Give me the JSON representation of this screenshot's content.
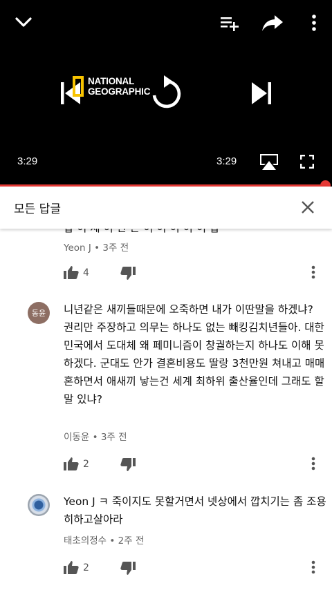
{
  "player": {
    "logo_line1": "NATIONAL",
    "logo_line2": "GEOGRAPHIC",
    "time_current": "3:29",
    "time_total": "3:29",
    "progress": 0.98,
    "accent_color": "#e53935",
    "icons": [
      "chevron-down-icon",
      "add-to-queue-icon",
      "share-icon",
      "more-vert-icon",
      "skip-previous-icon",
      "replay-icon",
      "skip-next-icon",
      "airplay-icon",
      "fullscreen-icon"
    ]
  },
  "header": {
    "title": "모든 답글",
    "close_icon": "close-icon"
  },
  "comments": [
    {
      "partial_text": "답 이 제 이 한 은 이 이 이 이 이 답",
      "author": "Yeon J",
      "age": "3주 전",
      "likes": "4"
    },
    {
      "avatar_text": "동윤",
      "text": "니년같은 새끼들때문에 오죽하면 내가 이딴말을 하겠냐? 권리만 주장하고 의무는 하나도 없는 빼킹김치년들아. 대한민국에서 도대체 왜 페미니즘이 창궐하는지 하나도 이해 못하겠다. 군대도 안가 결혼비용도 딸랑 3천만원 쳐내고 매매혼하면서 애새끼 낳는건 세계 최하위 출산율인데 그래도 할말 있냐?",
      "author": "이동윤",
      "age": "3주 전",
      "likes": "2"
    },
    {
      "text": "Yeon J ㅋ 죽이지도 못할거면서 넷상에서 깝치기는 좀 조용히하고살아라",
      "author": "태초의정수",
      "age": "2주 전",
      "likes": "2"
    }
  ],
  "meta_separator": "•"
}
